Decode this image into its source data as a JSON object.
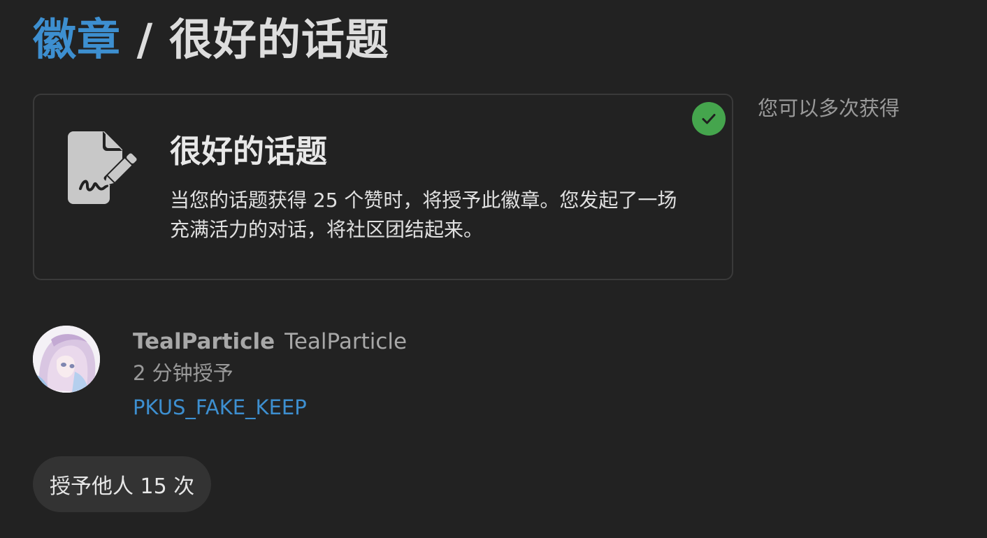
{
  "header": {
    "breadcrumb_link": "徽章",
    "separator": "/",
    "current": "很好的话题"
  },
  "badge": {
    "icon": "document-signature-icon",
    "name": "很好的话题",
    "description": "当您的话题获得 25 个赞时，将授予此徽章。您发起了一场充满活力的对话，将社区团结起来。",
    "granted_icon": "check-circle-icon",
    "multi_note": "您可以多次获得"
  },
  "grant": {
    "username": "TealParticle",
    "fullname": "TealParticle",
    "time": "2 分钟授予",
    "topic": "PKUS_FAKE_KEEP"
  },
  "granted_count": "授予他人 15 次",
  "colors": {
    "background": "#222222",
    "link": "#3d8fd0",
    "check": "#45a54d",
    "muted": "#9a9a9a"
  }
}
